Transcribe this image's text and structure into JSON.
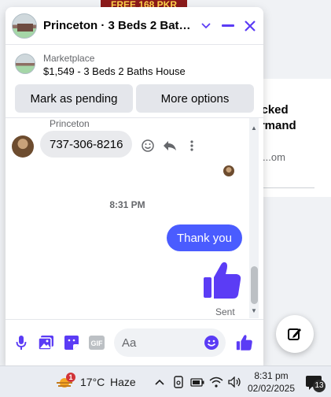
{
  "background": {
    "banner": "FREE 168 PKR",
    "title": "...cked Armand",
    "sub": "...om"
  },
  "chat": {
    "title": "Princeton · 3 Beds 2 Bath...",
    "listing": {
      "source": "Marketplace",
      "name": "$1,549 - 3 Beds 2 Baths House"
    },
    "actions": {
      "mark_pending": "Mark as pending",
      "more_options": "More options"
    },
    "thread": {
      "sender_name": "Princeton",
      "incoming_message": "737-306-8216",
      "timestamp": "8:31 PM",
      "outgoing_message": "Thank you",
      "status": "Sent"
    },
    "composer": {
      "placeholder": "Aa"
    },
    "accent_color": "#5b3cf5"
  },
  "taskbar": {
    "weather_badge": "1",
    "temperature": "17°C",
    "condition": "Haze",
    "time": "8:31 pm",
    "date": "02/02/2025",
    "notification_count": "13"
  }
}
